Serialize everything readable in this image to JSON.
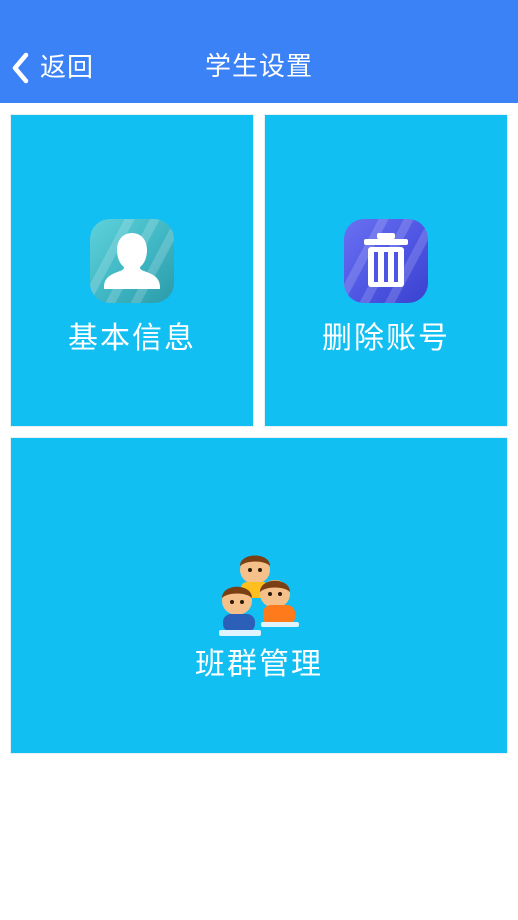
{
  "header": {
    "back_label": "返回",
    "title": "学生设置",
    "background_color": "#3b82f6"
  },
  "tiles": [
    {
      "label": "基本信息",
      "icon": "person-icon",
      "color": "#12bff2"
    },
    {
      "label": "删除账号",
      "icon": "trash-icon",
      "color": "#12bff2"
    },
    {
      "label": "班群管理",
      "icon": "students-group-icon",
      "color": "#12bff2"
    }
  ]
}
